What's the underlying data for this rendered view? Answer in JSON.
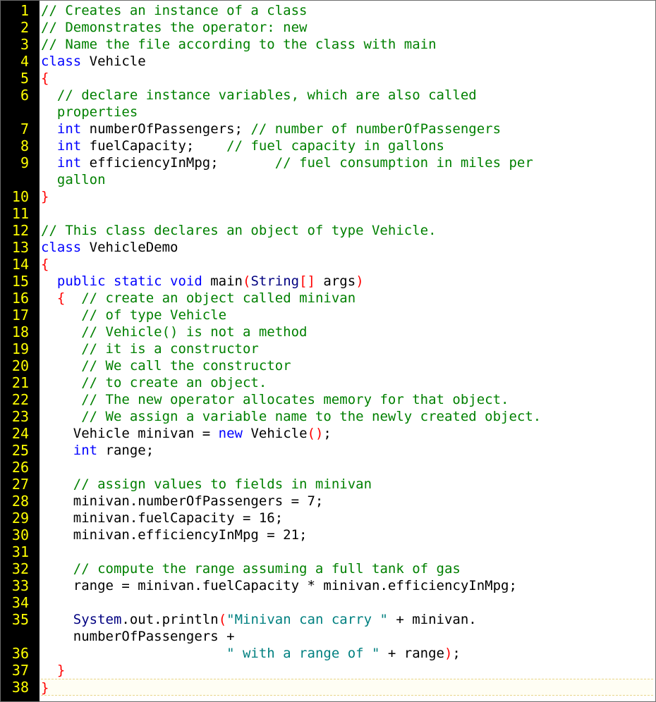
{
  "editor": {
    "lines": [
      {
        "n": "1",
        "segs": [
          {
            "t": "// Creates an instance of a class",
            "c": "cmt"
          }
        ]
      },
      {
        "n": "2",
        "segs": [
          {
            "t": "// Demonstrates the operator: new",
            "c": "cmt"
          }
        ]
      },
      {
        "n": "3",
        "segs": [
          {
            "t": "// Name the file according to the class with main",
            "c": "cmt"
          }
        ]
      },
      {
        "n": "4",
        "segs": [
          {
            "t": "class",
            "c": "kw"
          },
          {
            "t": " Vehicle",
            "c": ""
          }
        ]
      },
      {
        "n": "5",
        "segs": [
          {
            "t": "{",
            "c": "br"
          }
        ]
      },
      {
        "n": "6",
        "segs": [
          {
            "t": "  // declare instance variables, which are also called\n  properties",
            "c": "cmt"
          }
        ]
      },
      {
        "n": "7",
        "segs": [
          {
            "t": "  ",
            "c": ""
          },
          {
            "t": "int",
            "c": "kw"
          },
          {
            "t": " numberOfPassengers; ",
            "c": ""
          },
          {
            "t": "// number of numberOfPassengers",
            "c": "cmt"
          }
        ]
      },
      {
        "n": "8",
        "segs": [
          {
            "t": "  ",
            "c": ""
          },
          {
            "t": "int",
            "c": "kw"
          },
          {
            "t": " fuelCapacity;    ",
            "c": ""
          },
          {
            "t": "// fuel capacity in gallons",
            "c": "cmt"
          }
        ]
      },
      {
        "n": "9",
        "segs": [
          {
            "t": "  ",
            "c": ""
          },
          {
            "t": "int",
            "c": "kw"
          },
          {
            "t": " efficiencyInMpg;       ",
            "c": ""
          },
          {
            "t": "// fuel consumption in miles per\n  gallon",
            "c": "cmt"
          }
        ]
      },
      {
        "n": "10",
        "segs": [
          {
            "t": "}",
            "c": "br"
          }
        ]
      },
      {
        "n": "11",
        "segs": []
      },
      {
        "n": "12",
        "segs": [
          {
            "t": "// This class declares an object of type Vehicle.",
            "c": "cmt"
          }
        ]
      },
      {
        "n": "13",
        "segs": [
          {
            "t": "class",
            "c": "kw"
          },
          {
            "t": " VehicleDemo",
            "c": ""
          }
        ]
      },
      {
        "n": "14",
        "segs": [
          {
            "t": "{",
            "c": "br"
          }
        ]
      },
      {
        "n": "15",
        "segs": [
          {
            "t": "  ",
            "c": ""
          },
          {
            "t": "public static void",
            "c": "kw"
          },
          {
            "t": " main",
            "c": ""
          },
          {
            "t": "(",
            "c": "br"
          },
          {
            "t": "String",
            "c": "ty"
          },
          {
            "t": "[]",
            "c": "br"
          },
          {
            "t": " args",
            "c": ""
          },
          {
            "t": ")",
            "c": "br"
          }
        ]
      },
      {
        "n": "16",
        "segs": [
          {
            "t": "  ",
            "c": ""
          },
          {
            "t": "{",
            "c": "br"
          },
          {
            "t": "  // create an object called minivan",
            "c": "cmt"
          }
        ]
      },
      {
        "n": "17",
        "segs": [
          {
            "t": "     // of type Vehicle",
            "c": "cmt"
          }
        ]
      },
      {
        "n": "18",
        "segs": [
          {
            "t": "     // Vehicle() is not a method",
            "c": "cmt"
          }
        ]
      },
      {
        "n": "19",
        "segs": [
          {
            "t": "     // it is a constructor",
            "c": "cmt"
          }
        ]
      },
      {
        "n": "20",
        "segs": [
          {
            "t": "     // We call the constructor",
            "c": "cmt"
          }
        ]
      },
      {
        "n": "21",
        "segs": [
          {
            "t": "     // to create an object.",
            "c": "cmt"
          }
        ]
      },
      {
        "n": "22",
        "segs": [
          {
            "t": "     // The new operator allocates memory for that object.",
            "c": "cmt"
          }
        ]
      },
      {
        "n": "23",
        "segs": [
          {
            "t": "     // We assign a variable name to the newly created object.",
            "c": "cmt"
          }
        ]
      },
      {
        "n": "24",
        "segs": [
          {
            "t": "    Vehicle minivan = ",
            "c": ""
          },
          {
            "t": "new",
            "c": "kw"
          },
          {
            "t": " Vehicle",
            "c": ""
          },
          {
            "t": "()",
            "c": "br"
          },
          {
            "t": ";",
            "c": ""
          }
        ]
      },
      {
        "n": "25",
        "segs": [
          {
            "t": "    ",
            "c": ""
          },
          {
            "t": "int",
            "c": "kw"
          },
          {
            "t": " range;",
            "c": ""
          }
        ]
      },
      {
        "n": "26",
        "segs": []
      },
      {
        "n": "27",
        "segs": [
          {
            "t": "    // assign values to fields in minivan",
            "c": "cmt"
          }
        ]
      },
      {
        "n": "28",
        "segs": [
          {
            "t": "    minivan.numberOfPassengers = 7;",
            "c": ""
          }
        ]
      },
      {
        "n": "29",
        "segs": [
          {
            "t": "    minivan.fuelCapacity = 16;",
            "c": ""
          }
        ]
      },
      {
        "n": "30",
        "segs": [
          {
            "t": "    minivan.efficiencyInMpg = 21;",
            "c": ""
          }
        ]
      },
      {
        "n": "31",
        "segs": []
      },
      {
        "n": "32",
        "segs": [
          {
            "t": "    // compute the range assuming a full tank of gas",
            "c": "cmt"
          }
        ]
      },
      {
        "n": "33",
        "segs": [
          {
            "t": "    range = minivan.fuelCapacity * minivan.efficiencyInMpg;",
            "c": ""
          }
        ]
      },
      {
        "n": "34",
        "segs": []
      },
      {
        "n": "35",
        "segs": [
          {
            "t": "    ",
            "c": ""
          },
          {
            "t": "System",
            "c": "ty"
          },
          {
            "t": ".out.println",
            "c": ""
          },
          {
            "t": "(",
            "c": "br"
          },
          {
            "t": "\"Minivan can carry \"",
            "c": "str"
          },
          {
            "t": " + minivan.\n    numberOfPassengers +",
            "c": ""
          }
        ]
      },
      {
        "n": "36",
        "segs": [
          {
            "t": "                       ",
            "c": ""
          },
          {
            "t": "\" with a range of \"",
            "c": "str"
          },
          {
            "t": " + range",
            "c": ""
          },
          {
            "t": ")",
            "c": "br"
          },
          {
            "t": ";",
            "c": ""
          }
        ]
      },
      {
        "n": "37",
        "segs": [
          {
            "t": "  ",
            "c": ""
          },
          {
            "t": "}",
            "c": "br"
          }
        ]
      },
      {
        "n": "38",
        "segs": [
          {
            "t": "}",
            "c": "br"
          }
        ],
        "current": true
      }
    ]
  }
}
